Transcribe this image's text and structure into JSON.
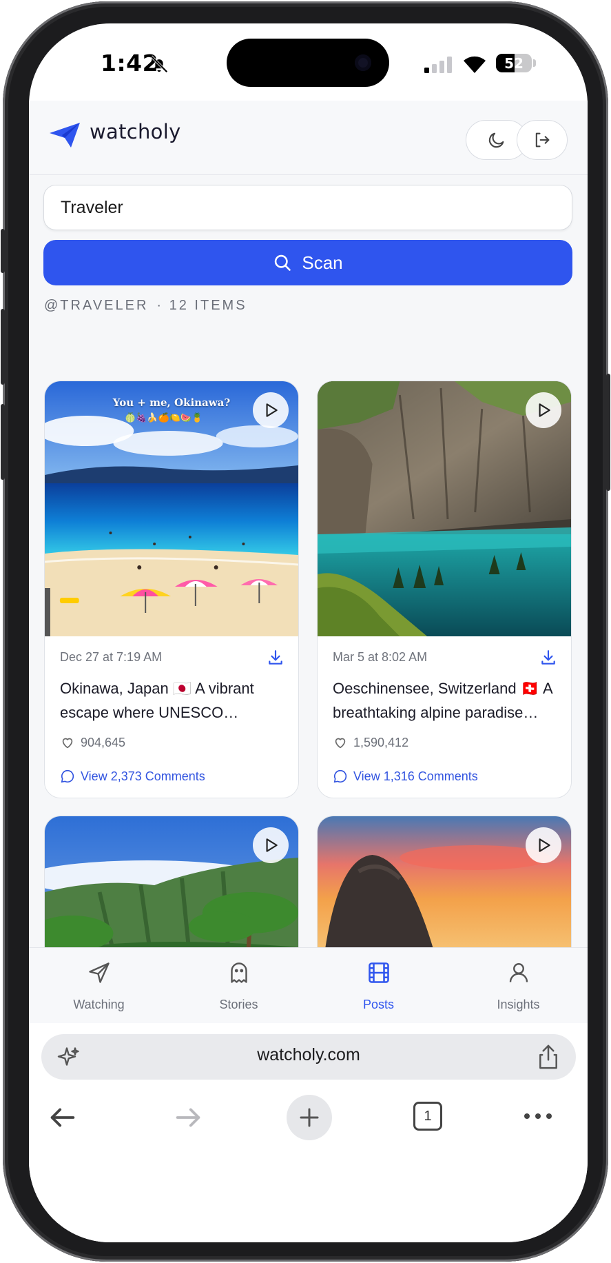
{
  "status_bar": {
    "time": "1:42",
    "battery": "52",
    "battery_level": 0.52
  },
  "app": {
    "brand": "watcholy",
    "search": {
      "value": "Traveler",
      "placeholder": ""
    },
    "scan_label": "Scan",
    "section": {
      "handle": "@TRAVELER",
      "count": "· 12 ITEMS"
    }
  },
  "posts": [
    {
      "thumb_caption": "You + me, Okinawa?",
      "date": "Dec 27 at 7:19 AM",
      "caption": "Okinawa, Japan 🇯🇵 A vibrant escape where UNESCO…",
      "likes": "904,645",
      "comments": "View 2,373 Comments"
    },
    {
      "date": "Mar 5 at 8:02 AM",
      "caption": "Oeschinensee, Switzerland 🇨🇭 A breathtaking alpine paradise…",
      "likes": "1,590,412",
      "comments": "View 1,316 Comments"
    },
    {},
    {}
  ],
  "tabbar": [
    {
      "label": "Watching",
      "icon": "paper-plane-icon"
    },
    {
      "label": "Stories",
      "icon": "ghost-icon"
    },
    {
      "label": "Posts",
      "icon": "film-icon",
      "active": true
    },
    {
      "label": "Insights",
      "icon": "person-icon"
    }
  ],
  "browser": {
    "url": "watcholy.com",
    "tab_count": "1"
  },
  "colors": {
    "accent": "#2f55ee",
    "text": "#1c1c28",
    "muted": "#6c707a"
  }
}
